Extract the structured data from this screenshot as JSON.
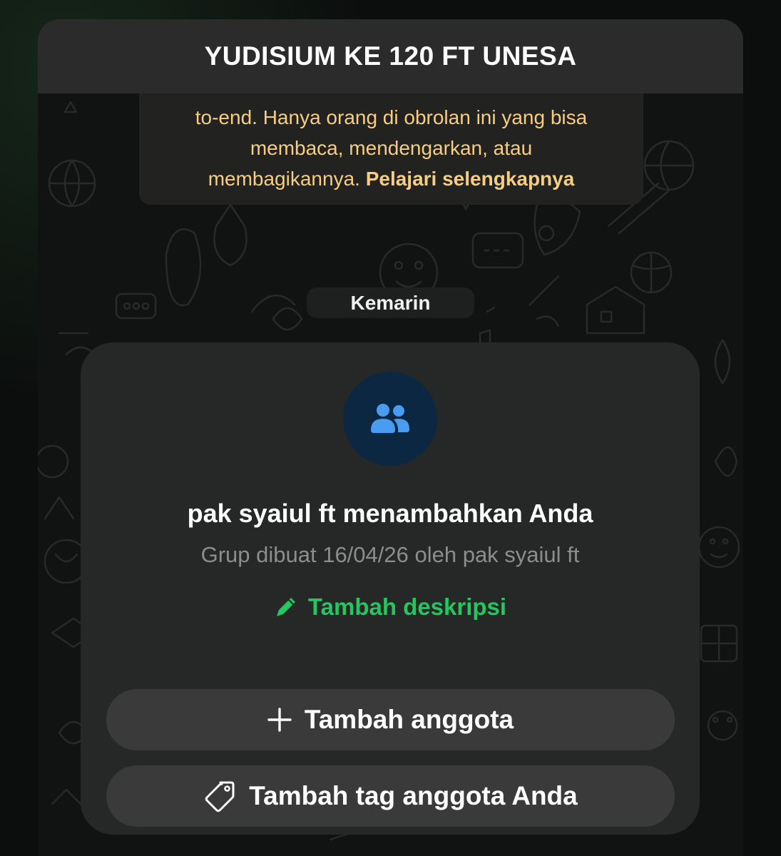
{
  "header": {
    "title": "YUDISIUM KE 120 FT UNESA"
  },
  "encryption_notice": {
    "line1": "to-end. Hanya orang di obrolan ini yang bisa",
    "line2": "membaca, mendengarkan, atau",
    "line3": "membagikannya.",
    "link": "Pelajari selengkapnya"
  },
  "date_chip": "Kemarin",
  "system_card": {
    "avatar_icon": "group-people-icon",
    "added_text": "pak syaiul ft menambahkan Anda",
    "created_text": "Grup dibuat 16/04/26 oleh pak syaiul ft",
    "add_description": {
      "icon": "pencil-icon",
      "label": "Tambah deskripsi"
    },
    "add_member": {
      "icon": "plus-icon",
      "label": "Tambah anggota"
    },
    "add_tag": {
      "icon": "tag-icon",
      "label": "Tambah tag anggota Anda"
    }
  },
  "colors": {
    "background": "#111312",
    "header": "#2b2b2b",
    "notice_text": "#f6cd83",
    "accent_green": "#25c560",
    "avatar_bg": "#0c2742",
    "avatar_icon": "#4a9cf0",
    "card_bg": "#262727",
    "button_bg": "#3a3a3a"
  }
}
